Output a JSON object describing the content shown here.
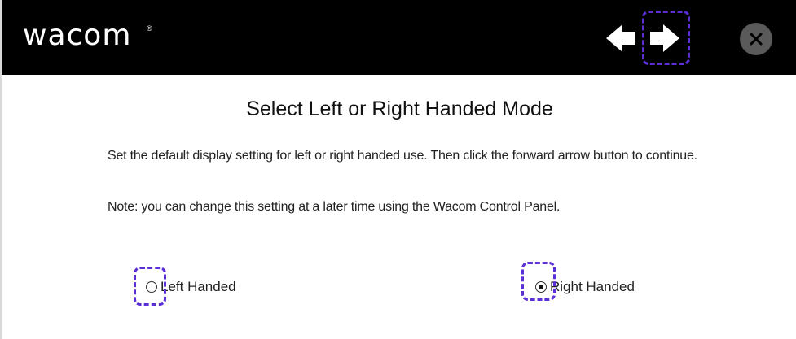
{
  "header": {
    "logo_text": "wacom",
    "logo_mark": "®",
    "nav": {
      "back_icon": "left-arrow-icon",
      "forward_icon": "right-arrow-icon",
      "close_icon": "close-icon"
    }
  },
  "main": {
    "title": "Select Left or Right Handed Mode",
    "description": "Set the default display setting for left or right handed use. Then click the forward arrow button to continue.",
    "note": "Note: you can change this setting at a later time using the Wacom Control Panel.",
    "options": [
      {
        "label": "Left Handed",
        "selected": false
      },
      {
        "label": "Right Handed",
        "selected": true
      }
    ]
  },
  "colors": {
    "header_bg": "#000000",
    "highlight": "#5b2fd6",
    "close_bg": "#5a5a5a"
  }
}
